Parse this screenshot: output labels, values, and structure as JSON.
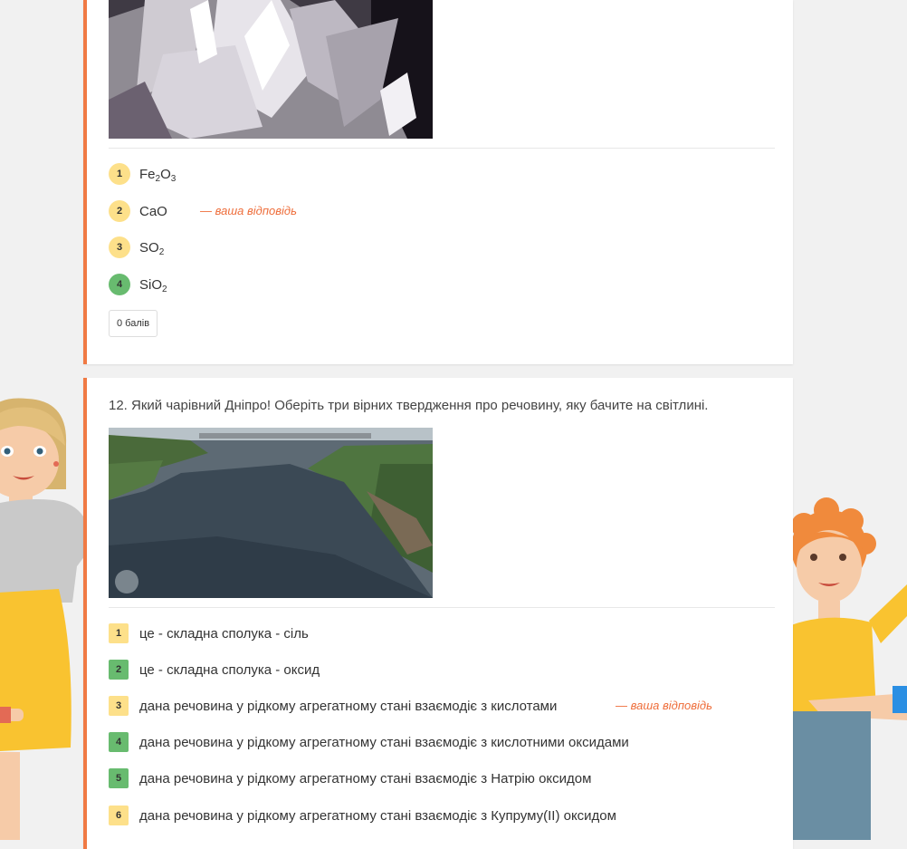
{
  "question11": {
    "options": [
      {
        "num": "1",
        "main": "Fe",
        "s1": "2",
        "mid": "O",
        "s2": "3",
        "state": "neutral"
      },
      {
        "num": "2",
        "main": "CaO",
        "s1": "",
        "mid": "",
        "s2": "",
        "state": "neutral",
        "your_answer": "— ваша відповідь"
      },
      {
        "num": "3",
        "main": "SO",
        "s1": "2",
        "mid": "",
        "s2": "",
        "state": "neutral"
      },
      {
        "num": "4",
        "main": "SiO",
        "s1": "2",
        "mid": "",
        "s2": "",
        "state": "correct"
      }
    ],
    "score_label": "0 балів"
  },
  "question12": {
    "text": "12. Який чарівний Дніпро! Оберіть три вірних твердження про речовину, яку бачите на світлині.",
    "options": [
      {
        "num": "1",
        "text": "це - складна сполука - сіль",
        "state": "neutral"
      },
      {
        "num": "2",
        "text": "це - складна сполука - оксид",
        "state": "correct"
      },
      {
        "num": "3",
        "text": "дана речовина у рідкому агрегатному стані взаємодіє з кислотами",
        "state": "neutral",
        "your_answer": "— ваша відповідь"
      },
      {
        "num": "4",
        "text": "дана речовина у рідкому агрегатному стані взаємодіє з кислотними оксидами",
        "state": "correct"
      },
      {
        "num": "5",
        "text": "дана речовина у рідкому агрегатному стані взаємодіє з Натрію оксидом",
        "state": "correct"
      },
      {
        "num": "6",
        "text": "дана речовина у рідкому агрегатному стані взаємодіє з Купруму(ІІ) оксидом",
        "state": "neutral"
      }
    ]
  },
  "colors": {
    "accent": "#f07a44",
    "neutral_badge": "#fde08a",
    "correct_badge": "#68bb6f",
    "your_answer": "#ee6d3a"
  },
  "images": {
    "crystals": "crystals-photo",
    "river": "dnipro-river-photo"
  },
  "decorations": {
    "left": "woman-illustration",
    "right": "boy-illustration"
  }
}
